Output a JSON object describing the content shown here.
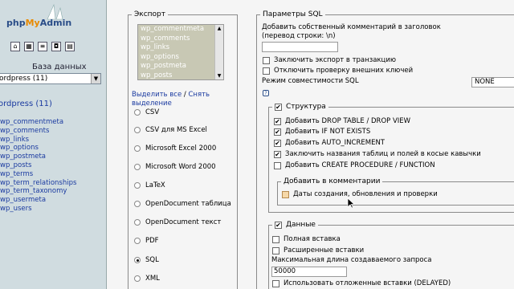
{
  "nav": {
    "logo": {
      "php": "php",
      "my": "My",
      "admin": "Admin"
    },
    "icons": [
      "home-icon",
      "table-icon",
      "sql-icon",
      "query-icon",
      "docs-icon"
    ],
    "db_label": "База данных",
    "db_select": "ordpress (11)",
    "db_title": "ordpress (11)",
    "tables": [
      "wp_commentmeta",
      "wp_comments",
      "wp_links",
      "wp_options",
      "wp_postmeta",
      "wp_posts",
      "wp_terms",
      "wp_term_relationships",
      "wp_term_taxonomy",
      "wp_usermeta",
      "wp_users"
    ]
  },
  "export": {
    "legend": "Экспорт",
    "tables": [
      "wp_commentmeta",
      "wp_comments",
      "wp_links",
      "wp_options",
      "wp_postmeta",
      "wp_posts"
    ],
    "select_all": "Выделить все",
    "separator": " / ",
    "deselect": "Снять выделение",
    "formats": [
      {
        "label": "CSV",
        "checked": false
      },
      {
        "label": "CSV для MS Excel",
        "checked": false
      },
      {
        "label": "Microsoft Excel 2000",
        "checked": false
      },
      {
        "label": "Microsoft Word 2000",
        "checked": false
      },
      {
        "label": "LaTeX",
        "checked": false
      },
      {
        "label": "OpenDocument таблица",
        "checked": false
      },
      {
        "label": "OpenDocument текст",
        "checked": false
      },
      {
        "label": "PDF",
        "checked": false
      },
      {
        "label": "SQL",
        "checked": true
      },
      {
        "label": "XML",
        "checked": false
      }
    ]
  },
  "sql": {
    "legend": "Параметры SQL",
    "comment_label": "Добавить собственный комментарий в заголовок (перевод строки: \\n)",
    "comment_value": "",
    "options": [
      {
        "label": "Заключить экспорт в транзакцию",
        "checked": false
      },
      {
        "label": "Отключить проверку внешних ключей",
        "checked": false
      }
    ],
    "compat_label": "Режим совместимости SQL",
    "compat_value": "NONE",
    "help": "?"
  },
  "structure": {
    "legend": "Структура",
    "checked": true,
    "options": [
      {
        "label": "Добавить DROP TABLE / DROP VIEW",
        "checked": true
      },
      {
        "label": "Добавить IF NOT EXISTS",
        "checked": true
      },
      {
        "label": "Добавить AUTO_INCREMENT",
        "checked": true
      },
      {
        "label": "Заключить названия таблиц и полей в косые кавычки",
        "checked": true
      },
      {
        "label": "Добавить CREATE PROCEDURE / FUNCTION",
        "checked": false
      }
    ],
    "comments_legend": "Добавить в комментарии",
    "dates_label": "Даты создания, обновления и проверки"
  },
  "data": {
    "legend": "Данные",
    "checked": true,
    "options": [
      {
        "label": "Полная вставка",
        "checked": false
      },
      {
        "label": "Расширенные вставки",
        "checked": false
      }
    ],
    "maxlen_label": "Максимальная длина создаваемого запроса",
    "maxlen_value": "50000",
    "delayed_label": "Использовать отложенные вставки (DELAYED)"
  }
}
